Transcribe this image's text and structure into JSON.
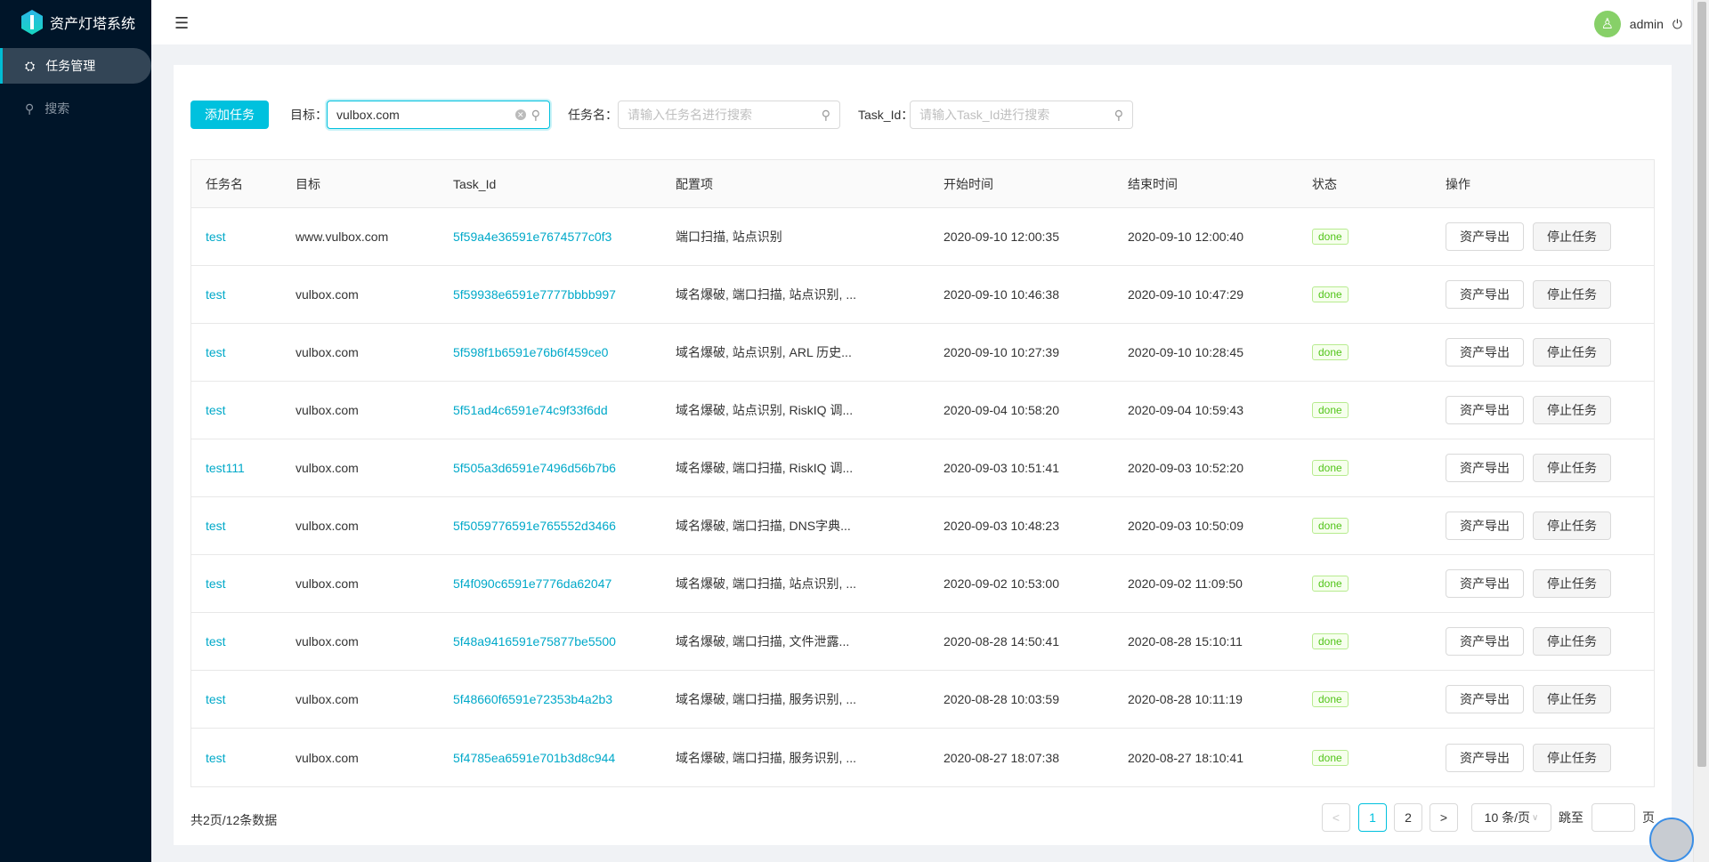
{
  "app": {
    "title": "资产灯塔系统"
  },
  "sidebar": {
    "items": [
      {
        "label": "任务管理",
        "icon": "sitemap-icon",
        "active": true
      },
      {
        "label": "搜索",
        "icon": "search-icon",
        "active": false
      }
    ]
  },
  "header": {
    "user": "admin"
  },
  "toolbar": {
    "add_label": "添加任务",
    "target_label": "目标：",
    "target_value": "vulbox.com",
    "name_label": "任务名：",
    "name_placeholder": "请输入任务名进行搜索",
    "taskid_label": "Task_Id：",
    "taskid_placeholder": "请输入Task_Id进行搜索"
  },
  "table": {
    "headers": [
      "任务名",
      "目标",
      "Task_Id",
      "配置项",
      "开始时间",
      "结束时间",
      "状态",
      "操作"
    ],
    "action_export": "资产导出",
    "action_stop": "停止任务",
    "rows": [
      {
        "name": "test",
        "target": "www.vulbox.com",
        "task_id": "5f59a4e36591e7674577c0f3",
        "config": "端口扫描, 站点识别",
        "start": "2020-09-10 12:00:35",
        "end": "2020-09-10 12:00:40",
        "status": "done"
      },
      {
        "name": "test",
        "target": "vulbox.com",
        "task_id": "5f59938e6591e7777bbbb997",
        "config": "域名爆破, 端口扫描, 站点识别, ...",
        "start": "2020-09-10 10:46:38",
        "end": "2020-09-10 10:47:29",
        "status": "done"
      },
      {
        "name": "test",
        "target": "vulbox.com",
        "task_id": "5f598f1b6591e76b6f459ce0",
        "config": "域名爆破, 站点识别, ARL 历史...",
        "start": "2020-09-10 10:27:39",
        "end": "2020-09-10 10:28:45",
        "status": "done"
      },
      {
        "name": "test",
        "target": "vulbox.com",
        "task_id": "5f51ad4c6591e74c9f33f6dd",
        "config": "域名爆破, 站点识别, RiskIQ 调...",
        "start": "2020-09-04 10:58:20",
        "end": "2020-09-04 10:59:43",
        "status": "done"
      },
      {
        "name": "test111",
        "target": "vulbox.com",
        "task_id": "5f505a3d6591e7496d56b7b6",
        "config": "域名爆破, 端口扫描, RiskIQ 调...",
        "start": "2020-09-03 10:51:41",
        "end": "2020-09-03 10:52:20",
        "status": "done"
      },
      {
        "name": "test",
        "target": "vulbox.com",
        "task_id": "5f5059776591e765552d3466",
        "config": "域名爆破, 端口扫描, DNS字典...",
        "start": "2020-09-03 10:48:23",
        "end": "2020-09-03 10:50:09",
        "status": "done"
      },
      {
        "name": "test",
        "target": "vulbox.com",
        "task_id": "5f4f090c6591e7776da62047",
        "config": "域名爆破, 端口扫描, 站点识别, ...",
        "start": "2020-09-02 10:53:00",
        "end": "2020-09-02 11:09:50",
        "status": "done"
      },
      {
        "name": "test",
        "target": "vulbox.com",
        "task_id": "5f48a9416591e75877be5500",
        "config": "域名爆破, 端口扫描, 文件泄露...",
        "start": "2020-08-28 14:50:41",
        "end": "2020-08-28 15:10:11",
        "status": "done"
      },
      {
        "name": "test",
        "target": "vulbox.com",
        "task_id": "5f48660f6591e72353b4a2b3",
        "config": "域名爆破, 端口扫描, 服务识别, ...",
        "start": "2020-08-28 10:03:59",
        "end": "2020-08-28 10:11:19",
        "status": "done"
      },
      {
        "name": "test",
        "target": "vulbox.com",
        "task_id": "5f4785ea6591e701b3d8c944",
        "config": "域名爆破, 端口扫描, 服务识别, ...",
        "start": "2020-08-27 18:07:38",
        "end": "2020-08-27 18:10:41",
        "status": "done"
      }
    ]
  },
  "pagination": {
    "total_text": "共2页/12条数据",
    "pages": [
      "1",
      "2"
    ],
    "current": "1",
    "prev": "<",
    "next": ">",
    "page_size": "10 条/页",
    "jump_label": "跳至",
    "jump_suffix": "页"
  },
  "colors": {
    "accent": "#00c1de",
    "sidebar": "#001529",
    "done": "#52c41a"
  }
}
